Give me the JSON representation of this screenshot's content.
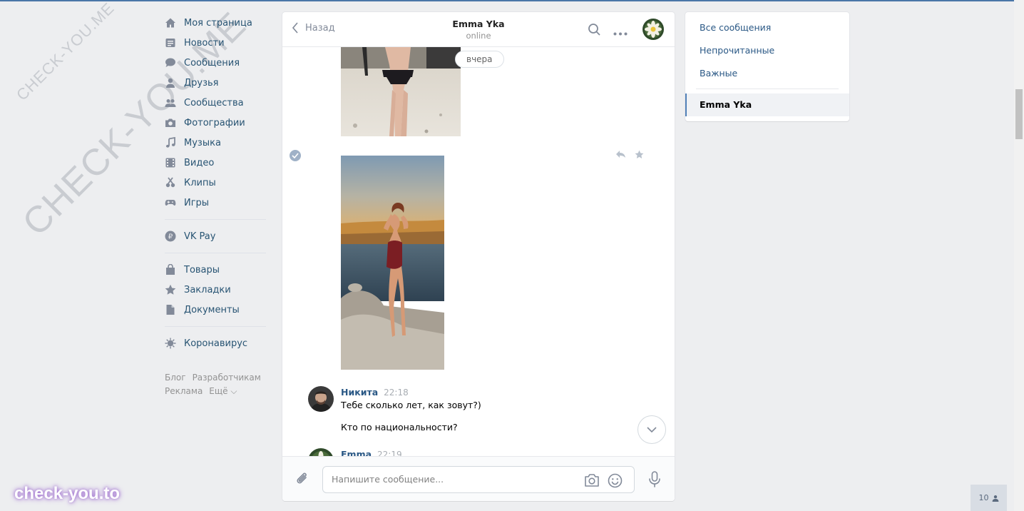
{
  "watermark": {
    "small": "CHECK-YOU.ME",
    "large": "CHECK-YOU.ME",
    "brand": "check-you.to"
  },
  "nav": {
    "items": [
      {
        "label": "Моя страница",
        "icon": "home-icon"
      },
      {
        "label": "Новости",
        "icon": "news-icon"
      },
      {
        "label": "Сообщения",
        "icon": "messages-icon"
      },
      {
        "label": "Друзья",
        "icon": "friends-icon"
      },
      {
        "label": "Сообщества",
        "icon": "communities-icon"
      },
      {
        "label": "Фотографии",
        "icon": "camera-icon"
      },
      {
        "label": "Музыка",
        "icon": "music-icon"
      },
      {
        "label": "Видео",
        "icon": "video-icon"
      },
      {
        "label": "Клипы",
        "icon": "clips-icon"
      },
      {
        "label": "Игры",
        "icon": "gamepad-icon"
      },
      {
        "label": "VK Pay",
        "icon": "vkpay-icon"
      },
      {
        "label": "Товары",
        "icon": "bag-icon"
      },
      {
        "label": "Закладки",
        "icon": "star-icon"
      },
      {
        "label": "Документы",
        "icon": "document-icon"
      },
      {
        "label": "Коронавирус",
        "icon": "virus-icon"
      }
    ],
    "footer": [
      "Блог",
      "Разработчикам",
      "Реклама",
      "Ещё ⌵"
    ]
  },
  "chat": {
    "back_label": "Назад",
    "peer_name": "Emma Yka",
    "peer_status": "online",
    "date_pill": "вчера",
    "messages": [
      {
        "author": "Никита",
        "time": "22:18",
        "lines": [
          "Тебе сколько лет, как зовут?)",
          "Кто по национальности?"
        ]
      },
      {
        "author": "Emma",
        "time": "22:19"
      }
    ],
    "composer_placeholder": "Напишите сообщение..."
  },
  "right_panel": {
    "items": [
      "Все сообщения",
      "Непрочитанные",
      "Важные"
    ],
    "active": "Emma Yka"
  },
  "online_count": "10",
  "colors": {
    "accent": "#4a76a8",
    "link": "#2a5885",
    "nav_text": "#285473",
    "background": "#edeef0"
  }
}
